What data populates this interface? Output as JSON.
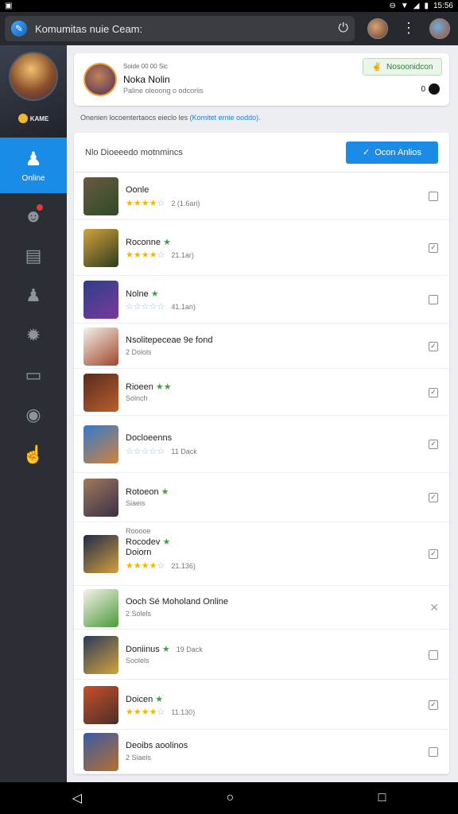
{
  "status_bar": {
    "left_icon": "app-notification-icon",
    "time": "15:56"
  },
  "browser": {
    "address_text": "Komumitas nuie Ceam:",
    "icons": [
      "reload-icon",
      "avatar",
      "more-vert-icon",
      "avatar"
    ]
  },
  "sidebar": {
    "brand_text": "KAME",
    "items": [
      {
        "label": "Online",
        "icon": "games-icon",
        "active": true
      },
      {
        "label": "",
        "icon": "chat-icon",
        "badge": true
      },
      {
        "label": "",
        "icon": "id-card-icon"
      },
      {
        "label": "",
        "icon": "people-icon"
      },
      {
        "label": "",
        "icon": "settings-icon"
      },
      {
        "label": "",
        "icon": "message-icon"
      },
      {
        "label": "",
        "icon": "play-icon"
      },
      {
        "label": "",
        "icon": "hand-icon"
      }
    ]
  },
  "profile": {
    "meta": "Soide 00 00 Sic",
    "name": "Noka Nolin",
    "status": "Paline oleoong o odcoriis",
    "chip_label": "Nosoonidcon",
    "online_value": "0"
  },
  "notice": {
    "text": "Onenien locoentertaocs eieclo les ",
    "link": "(Komitet ernie ooddo)."
  },
  "list": {
    "header_label": "Nlo Dioeeedo motnmincs",
    "primary_button": "Ocon Anlios",
    "rows": [
      {
        "name": "Oonle",
        "stars": 4,
        "count": "2 (1.6ari)",
        "line2": "",
        "check": "box",
        "colors": [
          "#6b5a3e",
          "#2d4a2a"
        ]
      },
      {
        "name": "Roconne",
        "badge": true,
        "stars": 4,
        "count": "21.1ar)",
        "line2": "",
        "check": "checked",
        "colors": [
          "#d2a23a",
          "#2f3b1f"
        ]
      },
      {
        "name": "Nolne",
        "badge": true,
        "stars": 0,
        "count": "41.1an)",
        "line2": "",
        "check": "box",
        "colors": [
          "#2c3f8a",
          "#7a3a9a"
        ]
      },
      {
        "name": "Nsolitepeceae 9e fond",
        "stars": -1,
        "count": "",
        "line2": "2 Dolols",
        "check": "checked",
        "colors": [
          "#f4f0ec",
          "#a0462a"
        ]
      },
      {
        "name": "Rioeen",
        "badge2": true,
        "stars": -1,
        "count": "",
        "line2": "Solnch",
        "check": "checked",
        "colors": [
          "#5a2a1e",
          "#b8602a"
        ]
      },
      {
        "name": "Docloeenns",
        "stars": 0,
        "count": "11 Dack",
        "line2": "",
        "check": "checked",
        "colors": [
          "#2e7bd0",
          "#d4823a"
        ]
      },
      {
        "name": "Rotoeon",
        "badge": true,
        "stars": -1,
        "count": "",
        "line2": "Siaeis",
        "check": "checked",
        "colors": [
          "#a07a5a",
          "#3a2e4a"
        ]
      },
      {
        "name": "Rocodev",
        "name2": "Doiorn",
        "meta": "Rooooe",
        "badge": true,
        "stars": 4,
        "count": "21.136)",
        "line2": "",
        "check": "checked",
        "colors": [
          "#1f2a4a",
          "#d4a03a"
        ]
      },
      {
        "name": "Ooch Sé Moholand Online",
        "stars": -1,
        "count": "",
        "line2": "2 Solels",
        "check": "x",
        "colors": [
          "#f6f2ea",
          "#4a9a3a"
        ]
      },
      {
        "name": "Doniinus",
        "badge": true,
        "stars": -1,
        "count": "19 Dack",
        "line2": "Soolels",
        "check": "box",
        "colors": [
          "#2a3a5a",
          "#d4a43a"
        ]
      },
      {
        "name": "Doicen",
        "badge": true,
        "stars": 4,
        "count": "11.130)",
        "line2": "",
        "check": "checked",
        "colors": [
          "#c8502a",
          "#4a2e2a"
        ]
      },
      {
        "name": "Deoibs aoolinos",
        "stars": -1,
        "count": "",
        "line2": "2 Siaels",
        "check": "box",
        "colors": [
          "#3a5aa8",
          "#b4702a"
        ]
      }
    ]
  },
  "nav": {
    "icons": [
      "back-icon",
      "home-icon",
      "recents-icon"
    ]
  }
}
